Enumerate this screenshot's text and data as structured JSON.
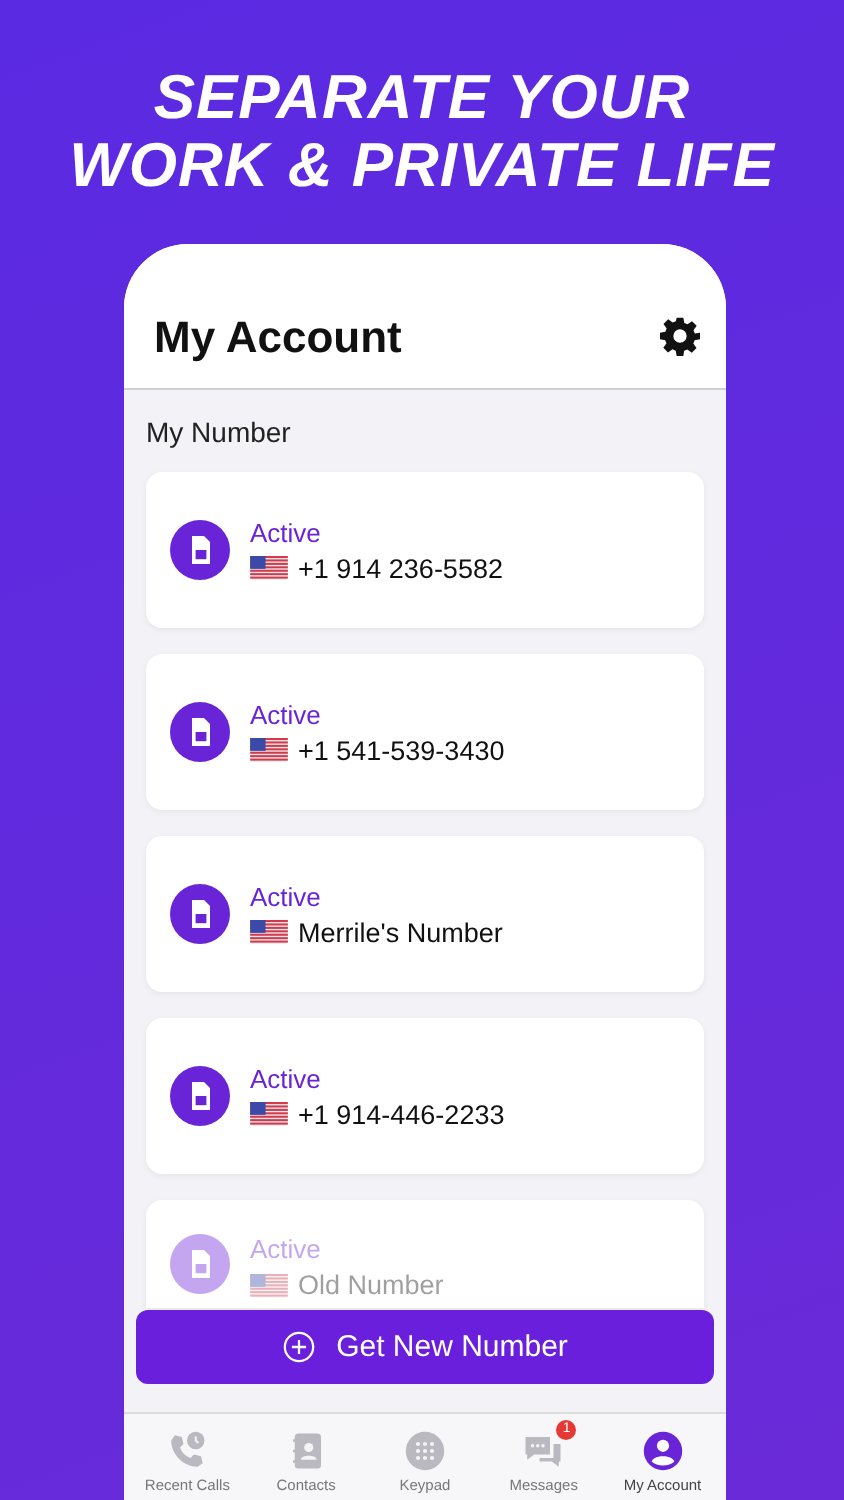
{
  "headline": {
    "lines": [
      "SEPARATE YOUR",
      "WORK & PRIVATE LIFE"
    ]
  },
  "header": {
    "title": "My Account"
  },
  "section": {
    "title": "My Number"
  },
  "numbers": [
    {
      "status": "Active",
      "label": "+1 914 236-5582",
      "dimmed": false
    },
    {
      "status": "Active",
      "label": "+1 541-539-3430",
      "dimmed": false
    },
    {
      "status": "Active",
      "label": "Merrile's Number",
      "dimmed": false
    },
    {
      "status": "Active",
      "label": "+1 914-446-2233",
      "dimmed": false
    },
    {
      "status": "Active",
      "label": "Old Number",
      "dimmed": true
    }
  ],
  "action_button": {
    "label": "Get New Number"
  },
  "tab_bar": [
    {
      "kind": "recent",
      "label": "Recent Calls",
      "selected": false
    },
    {
      "kind": "contacts",
      "label": "Contacts",
      "selected": false
    },
    {
      "kind": "keypad",
      "label": "Keypad",
      "selected": false
    },
    {
      "kind": "messages",
      "label": "Messages",
      "selected": false,
      "badge": "1"
    },
    {
      "kind": "account",
      "label": "My Account",
      "selected": true
    }
  ]
}
